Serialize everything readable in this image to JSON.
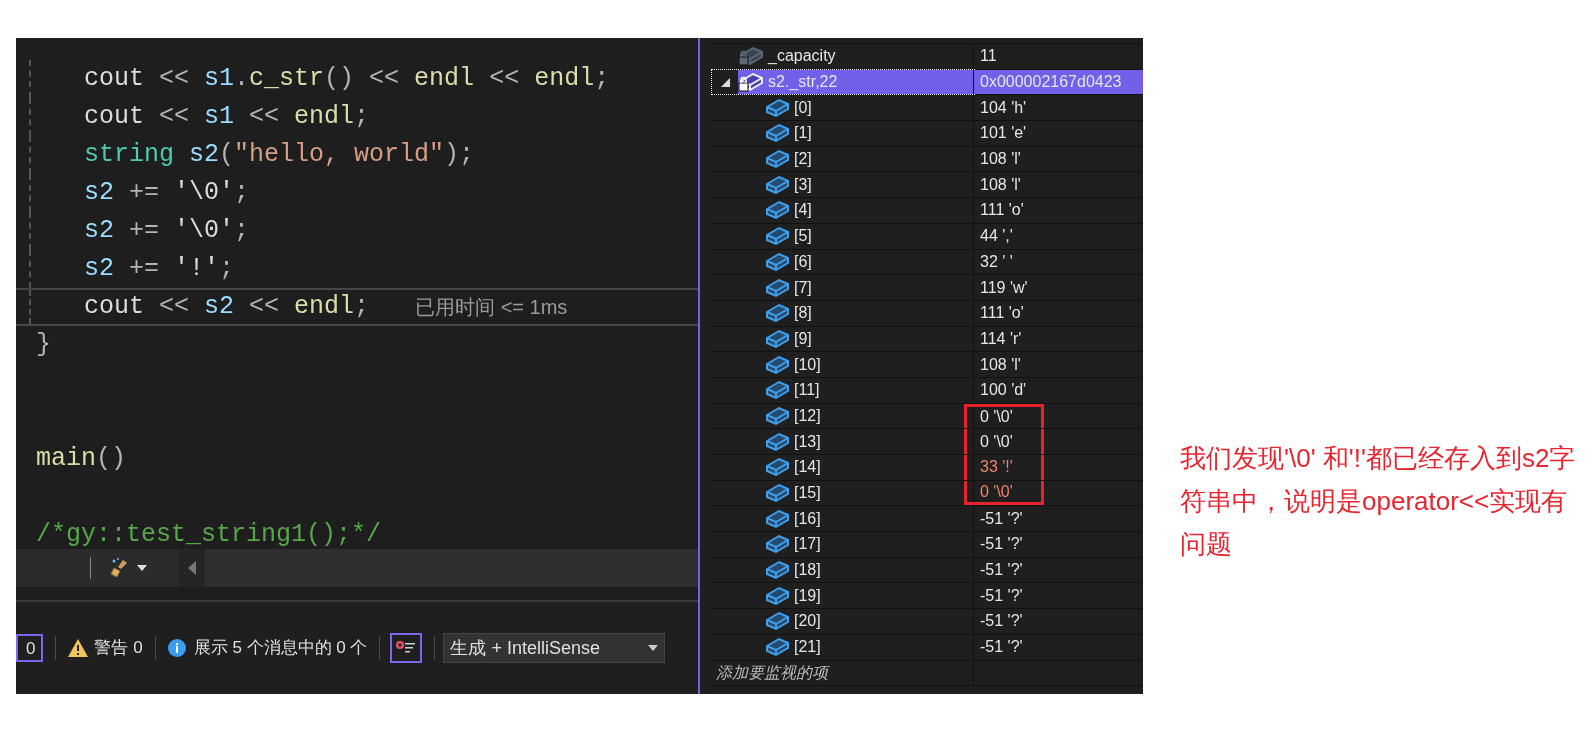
{
  "editor": {
    "code_lines": [
      {
        "kind": "code",
        "indented": true,
        "current": false,
        "tokens": [
          {
            "text": "cout",
            "kind": "plain"
          },
          {
            "text": " << ",
            "kind": "op"
          },
          {
            "text": "s1",
            "kind": "var"
          },
          {
            "text": ".",
            "kind": "op"
          },
          {
            "text": "c_str",
            "kind": "func"
          },
          {
            "text": "()",
            "kind": "op"
          },
          {
            "text": " << ",
            "kind": "op"
          },
          {
            "text": "endl",
            "kind": "func"
          },
          {
            "text": " << ",
            "kind": "op"
          },
          {
            "text": "endl",
            "kind": "func"
          },
          {
            "text": ";",
            "kind": "op"
          }
        ]
      },
      {
        "kind": "code",
        "indented": true,
        "current": false,
        "tokens": [
          {
            "text": "cout",
            "kind": "plain"
          },
          {
            "text": " << ",
            "kind": "op"
          },
          {
            "text": "s1",
            "kind": "var"
          },
          {
            "text": " << ",
            "kind": "op"
          },
          {
            "text": "endl",
            "kind": "func"
          },
          {
            "text": ";",
            "kind": "op"
          }
        ]
      },
      {
        "kind": "code",
        "indented": true,
        "current": false,
        "tokens": [
          {
            "text": "string ",
            "kind": "type"
          },
          {
            "text": "s2",
            "kind": "var"
          },
          {
            "text": "(",
            "kind": "op"
          },
          {
            "text": "\"hello, world\"",
            "kind": "string"
          },
          {
            "text": ");",
            "kind": "op"
          }
        ]
      },
      {
        "kind": "code",
        "indented": true,
        "current": false,
        "tokens": [
          {
            "text": "s2",
            "kind": "var"
          },
          {
            "text": " += ",
            "kind": "op"
          },
          {
            "text": "'\\0'",
            "kind": "plain"
          },
          {
            "text": ";",
            "kind": "op"
          }
        ]
      },
      {
        "kind": "code",
        "indented": true,
        "current": false,
        "tokens": [
          {
            "text": "s2",
            "kind": "var"
          },
          {
            "text": " += ",
            "kind": "op"
          },
          {
            "text": "'\\0'",
            "kind": "plain"
          },
          {
            "text": ";",
            "kind": "op"
          }
        ]
      },
      {
        "kind": "code",
        "indented": true,
        "current": false,
        "tokens": [
          {
            "text": "s2",
            "kind": "var"
          },
          {
            "text": " += ",
            "kind": "op"
          },
          {
            "text": "'!'",
            "kind": "plain"
          },
          {
            "text": ";",
            "kind": "op"
          }
        ]
      },
      {
        "kind": "code",
        "indented": true,
        "current": true,
        "hint": "已用时间 <= 1ms",
        "tokens": [
          {
            "text": "cout",
            "kind": "plain"
          },
          {
            "text": " << ",
            "kind": "op"
          },
          {
            "text": "s2",
            "kind": "var"
          },
          {
            "text": " << ",
            "kind": "op"
          },
          {
            "text": "endl",
            "kind": "func"
          },
          {
            "text": ";",
            "kind": "op"
          }
        ]
      },
      {
        "kind": "code",
        "indented": false,
        "current": false,
        "tokens": [
          {
            "text": "}",
            "kind": "op"
          }
        ]
      },
      {
        "kind": "blank"
      },
      {
        "kind": "blank"
      },
      {
        "kind": "code",
        "indented": false,
        "current": false,
        "tokens": [
          {
            "text": "main",
            "kind": "func"
          },
          {
            "text": "()",
            "kind": "op"
          }
        ]
      },
      {
        "kind": "blank"
      },
      {
        "kind": "code",
        "indented": false,
        "current": false,
        "tokens": [
          {
            "text": "/*gy::test_string1();*/",
            "kind": "comment"
          }
        ]
      }
    ]
  },
  "error_list": {
    "errors": {
      "label": "0",
      "selected": true
    },
    "warnings": "警告 0",
    "messages": "展示 5 个消息中的 0 个",
    "filter_selected": true,
    "source": "生成 + IntelliSense"
  },
  "watch": {
    "rows": [
      {
        "name": "_capacity",
        "value": "11",
        "kind": "private",
        "selected": false,
        "changed": false
      },
      {
        "name": "s2._str,22",
        "value": "0x000002167d0423",
        "kind": "private",
        "selected": true,
        "changed": false,
        "expanded": true,
        "children": [
          {
            "name": "[0]",
            "value": "104 'h'",
            "kind": "element",
            "selected": false,
            "changed": false,
            "highlighted": false
          },
          {
            "name": "[1]",
            "value": "101 'e'",
            "kind": "element",
            "selected": false,
            "changed": false,
            "highlighted": false
          },
          {
            "name": "[2]",
            "value": "108 'l'",
            "kind": "element",
            "selected": false,
            "changed": false,
            "highlighted": false
          },
          {
            "name": "[3]",
            "value": "108 'l'",
            "kind": "element",
            "selected": false,
            "changed": false,
            "highlighted": false
          },
          {
            "name": "[4]",
            "value": "111 'o'",
            "kind": "element",
            "selected": false,
            "changed": false,
            "highlighted": false
          },
          {
            "name": "[5]",
            "value": "44 ','",
            "kind": "element",
            "selected": false,
            "changed": false,
            "highlighted": false
          },
          {
            "name": "[6]",
            "value": "32 ' '",
            "kind": "element",
            "selected": false,
            "changed": false,
            "highlighted": false
          },
          {
            "name": "[7]",
            "value": "119 'w'",
            "kind": "element",
            "selected": false,
            "changed": false,
            "highlighted": false
          },
          {
            "name": "[8]",
            "value": "111 'o'",
            "kind": "element",
            "selected": false,
            "changed": false,
            "highlighted": false
          },
          {
            "name": "[9]",
            "value": "114 'r'",
            "kind": "element",
            "selected": false,
            "changed": false,
            "highlighted": false
          },
          {
            "name": "[10]",
            "value": "108 'l'",
            "kind": "element",
            "selected": false,
            "changed": false,
            "highlighted": false
          },
          {
            "name": "[11]",
            "value": "100 'd'",
            "kind": "element",
            "selected": false,
            "changed": false,
            "highlighted": false
          },
          {
            "name": "[12]",
            "value": "0 '\\0'",
            "kind": "element",
            "selected": false,
            "changed": false,
            "highlighted": true
          },
          {
            "name": "[13]",
            "value": "0 '\\0'",
            "kind": "element",
            "selected": false,
            "changed": false,
            "highlighted": true
          },
          {
            "name": "[14]",
            "value": "33 '!'",
            "kind": "element",
            "selected": false,
            "changed": true,
            "highlighted": true
          },
          {
            "name": "[15]",
            "value": "0 '\\0'",
            "kind": "element",
            "selected": false,
            "changed": true,
            "highlighted": true
          },
          {
            "name": "[16]",
            "value": "-51 '?'",
            "kind": "element",
            "selected": false,
            "changed": false,
            "highlighted": false
          },
          {
            "name": "[17]",
            "value": "-51 '?'",
            "kind": "element",
            "selected": false,
            "changed": false,
            "highlighted": false
          },
          {
            "name": "[18]",
            "value": "-51 '?'",
            "kind": "element",
            "selected": false,
            "changed": false,
            "highlighted": false
          },
          {
            "name": "[19]",
            "value": "-51 '?'",
            "kind": "element",
            "selected": false,
            "changed": false,
            "highlighted": false
          },
          {
            "name": "[20]",
            "value": "-51 '?'",
            "kind": "element",
            "selected": false,
            "changed": false,
            "highlighted": false
          },
          {
            "name": "[21]",
            "value": "-51 '?'",
            "kind": "element",
            "selected": false,
            "changed": false,
            "highlighted": false
          }
        ]
      }
    ],
    "add_placeholder": "添加要监视的项"
  },
  "annotation": "我们发现'\\0' 和'!'都已经存入到s2字符串中，说明是operator<<实现有问题"
}
